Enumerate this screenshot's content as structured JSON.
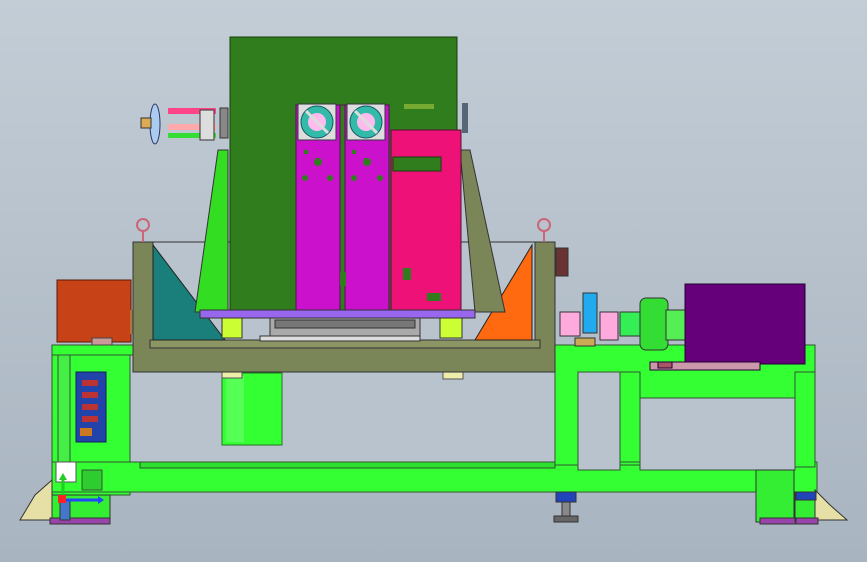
{
  "scene": {
    "kind": "cad-assembly-side-view",
    "background": "#b8c3cd",
    "components": [
      {
        "id": "base-frame",
        "color": "#33ff33"
      },
      {
        "id": "tank-tub",
        "color": "#7a8558"
      },
      {
        "id": "tower-housing",
        "color": "#2f7d1c"
      },
      {
        "id": "magenta-panel",
        "color": "#cc11cc"
      },
      {
        "id": "pink-panel",
        "color": "#ee1177"
      },
      {
        "id": "motor",
        "color": "#66007a"
      },
      {
        "id": "control-box",
        "color": "#c84218"
      },
      {
        "id": "hydraulic-cylinder",
        "color": "#33ff33"
      },
      {
        "id": "coupling",
        "color": "#33dd33"
      },
      {
        "id": "left-gusset",
        "color": "#1a7f7a"
      },
      {
        "id": "right-gusset",
        "color": "#ff6a10"
      }
    ],
    "icons": [
      "coordinate-axis-icon",
      "fan-icon",
      "lifting-eye-icon",
      "handwheel-icon"
    ]
  }
}
